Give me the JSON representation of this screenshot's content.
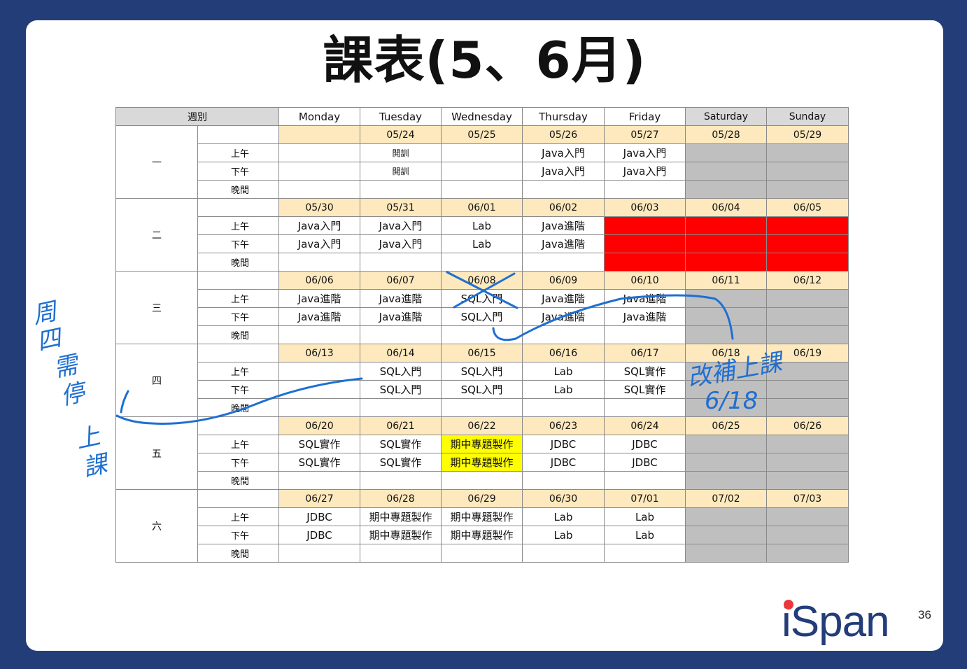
{
  "title": "課表(5、6月)",
  "page_number": "36",
  "logo_text": "iSpan",
  "colors": {
    "accent": "#e8383d",
    "frame": "#233d79",
    "date_fill": "#fde9bd",
    "weekend_fill": "#bfbfbf",
    "ink": "#1f6fd1"
  },
  "table": {
    "week_header": "週別",
    "days": [
      "Monday",
      "Tuesday",
      "Wednesday",
      "Thursday",
      "Friday",
      "Saturday",
      "Sunday"
    ],
    "slots": [
      "上午",
      "下午",
      "晚間"
    ],
    "weeks": [
      {
        "label": "一",
        "dates": [
          "",
          "05/24",
          "05/25",
          "05/26",
          "05/27",
          "05/28",
          "05/29"
        ],
        "rows": [
          [
            "",
            "開訓",
            "",
            "Java入門",
            "Java入門",
            "",
            ""
          ],
          [
            "",
            "開訓",
            "",
            "Java入門",
            "Java入門",
            "",
            ""
          ],
          [
            "",
            "",
            "",
            "",
            "",
            "",
            ""
          ]
        ],
        "fills": [
          [
            "w",
            "w",
            "w",
            "w",
            "w",
            "g",
            "g"
          ],
          [
            "w",
            "w",
            "w",
            "w",
            "w",
            "g",
            "g"
          ],
          [
            "w",
            "w",
            "w",
            "w",
            "w",
            "g",
            "g"
          ]
        ]
      },
      {
        "label": "二",
        "dates": [
          "05/30",
          "05/31",
          "06/01",
          "06/02",
          "06/03",
          "06/04",
          "06/05"
        ],
        "rows": [
          [
            "Java入門",
            "Java入門",
            "Lab",
            "Java進階",
            "",
            "",
            ""
          ],
          [
            "Java入門",
            "Java入門",
            "Lab",
            "Java進階",
            "",
            "",
            ""
          ],
          [
            "",
            "",
            "",
            "",
            "",
            "",
            ""
          ]
        ],
        "fills": [
          [
            "w",
            "w",
            "w",
            "w",
            "r",
            "r",
            "r"
          ],
          [
            "w",
            "w",
            "w",
            "w",
            "r",
            "r",
            "r"
          ],
          [
            "w",
            "w",
            "w",
            "w",
            "r",
            "r",
            "r"
          ]
        ]
      },
      {
        "label": "三",
        "dates": [
          "06/06",
          "06/07",
          "06/08",
          "06/09",
          "06/10",
          "06/11",
          "06/12"
        ],
        "rows": [
          [
            "Java進階",
            "Java進階",
            "SQL入門",
            "Java進階",
            "Java進階",
            "",
            ""
          ],
          [
            "Java進階",
            "Java進階",
            "SQL入門",
            "Java進階",
            "Java進階",
            "",
            ""
          ],
          [
            "",
            "",
            "",
            "",
            "",
            "",
            ""
          ]
        ],
        "fills": [
          [
            "w",
            "w",
            "w",
            "w",
            "w",
            "g",
            "g"
          ],
          [
            "w",
            "w",
            "w",
            "w",
            "w",
            "g",
            "g"
          ],
          [
            "w",
            "w",
            "w",
            "w",
            "w",
            "g",
            "g"
          ]
        ]
      },
      {
        "label": "四",
        "dates": [
          "06/13",
          "06/14",
          "06/15",
          "06/16",
          "06/17",
          "06/18",
          "06/19"
        ],
        "rows": [
          [
            "",
            "SQL入門",
            "SQL入門",
            "Lab",
            "SQL實作",
            "",
            ""
          ],
          [
            "",
            "SQL入門",
            "SQL入門",
            "Lab",
            "SQL實作",
            "",
            ""
          ],
          [
            "",
            "",
            "",
            "",
            "",
            "",
            ""
          ]
        ],
        "fills": [
          [
            "w",
            "w",
            "w",
            "w",
            "w",
            "g",
            "g"
          ],
          [
            "w",
            "w",
            "w",
            "w",
            "w",
            "g",
            "g"
          ],
          [
            "w",
            "w",
            "w",
            "w",
            "w",
            "g",
            "g"
          ]
        ]
      },
      {
        "label": "五",
        "dates": [
          "06/20",
          "06/21",
          "06/22",
          "06/23",
          "06/24",
          "06/25",
          "06/26"
        ],
        "rows": [
          [
            "SQL實作",
            "SQL實作",
            "期中專題製作",
            "JDBC",
            "JDBC",
            "",
            ""
          ],
          [
            "SQL實作",
            "SQL實作",
            "期中專題製作",
            "JDBC",
            "JDBC",
            "",
            ""
          ],
          [
            "",
            "",
            "",
            "",
            "",
            "",
            ""
          ]
        ],
        "fills": [
          [
            "w",
            "w",
            "y",
            "w",
            "w",
            "g",
            "g"
          ],
          [
            "w",
            "w",
            "y",
            "w",
            "w",
            "g",
            "g"
          ],
          [
            "w",
            "w",
            "w",
            "w",
            "w",
            "g",
            "g"
          ]
        ]
      },
      {
        "label": "六",
        "dates": [
          "06/27",
          "06/28",
          "06/29",
          "06/30",
          "07/01",
          "07/02",
          "07/03"
        ],
        "rows": [
          [
            "JDBC",
            "期中專題製作",
            "期中專題製作",
            "Lab",
            "Lab",
            "",
            ""
          ],
          [
            "JDBC",
            "期中專題製作",
            "期中專題製作",
            "Lab",
            "Lab",
            "",
            ""
          ],
          [
            "",
            "",
            "",
            "",
            "",
            "",
            ""
          ]
        ],
        "fills": [
          [
            "w",
            "w",
            "w",
            "w",
            "w",
            "g",
            "g"
          ],
          [
            "w",
            "w",
            "w",
            "w",
            "w",
            "g",
            "g"
          ],
          [
            "w",
            "w",
            "w",
            "w",
            "w",
            "g",
            "g"
          ]
        ]
      }
    ]
  },
  "annotations": {
    "left_note": [
      "周",
      "四",
      "需",
      "停",
      "上",
      "課"
    ],
    "right_note": "改補上課",
    "right_date": "6/18"
  }
}
